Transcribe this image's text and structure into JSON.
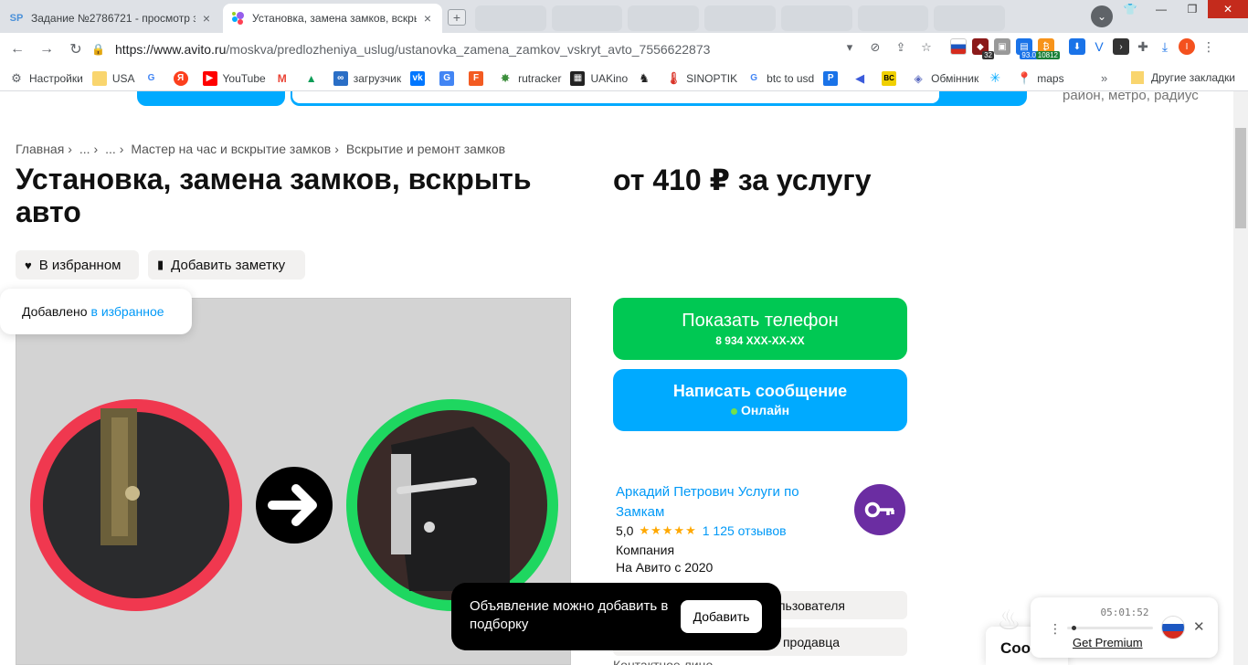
{
  "browser": {
    "tabs": [
      {
        "title": "Задание №2786721 - просмотр з",
        "favicon": "SP",
        "active": false
      },
      {
        "title": "Установка, замена замков, вскры",
        "favicon": "avito",
        "active": true
      }
    ],
    "url_host": "https://www.avito.ru",
    "url_path": "/moskva/predlozheniya_uslug/ustanovka_zamena_zamkov_vskryt_avto_7556622873",
    "extension_badges": {
      "ext1": "32",
      "ext2": "93.0",
      "ext3": "10812"
    },
    "bookmarks": [
      {
        "label": "Настройки",
        "icon": "gear-icon"
      },
      {
        "label": "USA",
        "icon": "folder-icon"
      },
      {
        "label": "",
        "icon": "google-icon"
      },
      {
        "label": "",
        "icon": "yandex-icon"
      },
      {
        "label": "YouTube",
        "icon": "youtube-icon"
      },
      {
        "label": "",
        "icon": "gmail-icon"
      },
      {
        "label": "",
        "icon": "drive-icon"
      },
      {
        "label": "загрузчик",
        "icon": "loader-icon"
      },
      {
        "label": "",
        "icon": "vk-icon"
      },
      {
        "label": "",
        "icon": "translate-icon"
      },
      {
        "label": "",
        "icon": "f-icon"
      },
      {
        "label": "rutracker",
        "icon": "rutracker-icon"
      },
      {
        "label": "UAKino",
        "icon": "uakino-icon"
      },
      {
        "label": "",
        "icon": "chess-icon"
      },
      {
        "label": "SINOPTIK",
        "icon": "thermometer-icon"
      },
      {
        "label": "btc to usd",
        "icon": "google-icon"
      },
      {
        "label": "",
        "icon": "p-icon"
      },
      {
        "label": "",
        "icon": "arrow-icon"
      },
      {
        "label": "",
        "icon": "bc-icon"
      },
      {
        "label": "Обмінник",
        "icon": "exchange-icon"
      },
      {
        "label": "",
        "icon": "star-icon"
      },
      {
        "label": "maps",
        "icon": "maps-icon"
      }
    ],
    "bookmarks_more": "»",
    "other_bookmarks": "Другие закладки"
  },
  "page": {
    "region_placeholder": "район, метро, радиус",
    "breadcrumb": [
      "Главная",
      "...",
      "...",
      "Мастер на час и вскрытие замков",
      "Вскрытие и ремонт замков"
    ],
    "breadcrumb_sep": "›",
    "title": "Установка, замена замков, вскрыть авто",
    "price": "от 410 ₽ за услугу",
    "fav_button": "В избранном",
    "note_button": "Добавить заметку",
    "fav_toast_text": "Добавлено",
    "fav_toast_link": "в избранное",
    "show_phone": "Показать телефон",
    "phone_masked": "8 934 XXX-XX-XX",
    "write_message": "Написать сообщение",
    "online": "Онлайн",
    "seller_name": "Аркадий Петрович Услуги по Замкам",
    "seller_rating": "5,0",
    "seller_stars": "★★★★★",
    "seller_reviews": "1 125 отзывов",
    "seller_type": "Компания",
    "seller_since": "На Авито с 2020",
    "other_ads": "льзователя",
    "subscribe": "продавца",
    "contact": "Контактное лицо",
    "compare_toast": "Объявление можно добавить в подборку",
    "compare_add": "Добавить",
    "cookie_text": "Coo"
  },
  "vpn": {
    "time": "05:01:52",
    "premium": "Get Premium",
    "progress": 0.05
  },
  "colors": {
    "green": "#00c853",
    "blue": "#00aaff",
    "link": "#0099f7",
    "avatar": "#6b2da2"
  }
}
